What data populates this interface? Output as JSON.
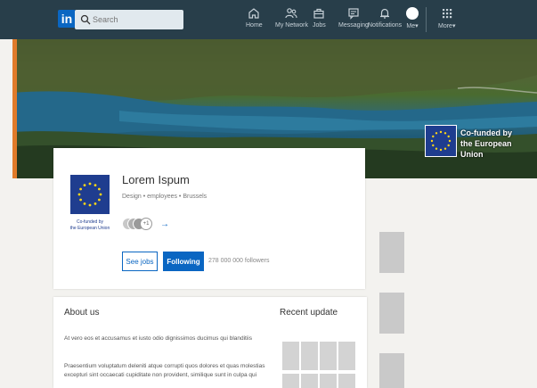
{
  "nav": {
    "logo_text": "in",
    "search_placeholder": "Search",
    "items": [
      {
        "label": "Home",
        "icon": "home-icon"
      },
      {
        "label": "My Network",
        "icon": "network-icon"
      },
      {
        "label": "Jobs",
        "icon": "briefcase-icon"
      },
      {
        "label": "Messaging",
        "icon": "messaging-icon"
      },
      {
        "label": "Notifications",
        "icon": "bell-icon"
      },
      {
        "label": "Me▾",
        "icon": "avatar"
      },
      {
        "label": "More▾",
        "icon": "grid-icon"
      }
    ]
  },
  "banner": {
    "eu_text_line1": "Co-funded by",
    "eu_text_line2": "the European Union"
  },
  "company": {
    "name": "Lorem Ispum",
    "meta": "Design • employees • Brussels",
    "logo_caption_line1": "Co-funded by",
    "logo_caption_line2": "the European Union",
    "followers_more": "+1",
    "arrow": "→",
    "see_jobs_label": "See jobs",
    "following_label": "Following",
    "followers_count": "278 000 000 followers"
  },
  "about": {
    "title": "About us",
    "paragraph1": "At vero eos et accusamus et iusto odio dignissimos ducimus qui blanditiis",
    "paragraph2": "Praesentium voluptatum deleniti atque corrupti quos dolores et quas molestias excepturi sint occaecati cupiditate non provident, similique sunt in culpa qui",
    "recent_title": "Recent update"
  },
  "colors": {
    "nav_bg": "#283e4a",
    "brand_blue": "#0a66c2",
    "eu_blue": "#1f3d8f",
    "eu_yellow": "#ffd617",
    "accent_orange": "#e07b2a"
  }
}
